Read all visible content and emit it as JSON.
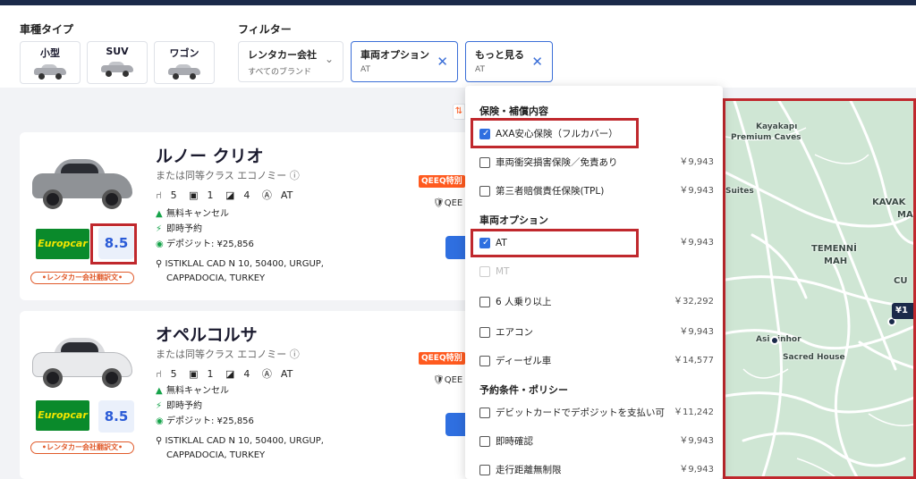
{
  "filters": {
    "car_type_label": "車種タイプ",
    "filter_label": "フィルター",
    "car_types": [
      {
        "label": "小型"
      },
      {
        "label": "SUV"
      },
      {
        "label": "ワゴン"
      }
    ],
    "rental_company": {
      "title": "レンタカー会社",
      "value": "すべてのブランド"
    },
    "vehicle_option": {
      "title": "車両オプション",
      "value": "AT"
    },
    "more": {
      "title": "もっと見る",
      "value": "AT"
    },
    "clear_icon": "✕",
    "chevron_icon": "⌄"
  },
  "results": [
    {
      "name": "ルノー クリオ",
      "subtitle": "または同等クラス エコノミー ⓘ",
      "seats": "5",
      "bags_large": "1",
      "doors": "4",
      "transmission": "AT",
      "free_cancel": "無料キャンセル",
      "instant": "即時予約",
      "deposit": "デポジット: ¥25,856",
      "supplier": "Europcar",
      "score": "8.5",
      "badge": "•レンタカー会社翻訳文•",
      "address_line1": "ISTIKLAL CAD N 10, 50400, URGUP,",
      "address_line2": "CAPPADOCIA, TURKEY",
      "promo": "QEEQ特別",
      "promo2": "QEE",
      "car_color": "#8f9296"
    },
    {
      "name": "オペルコルサ",
      "subtitle": "または同等クラス エコノミー ⓘ",
      "seats": "5",
      "bags_large": "1",
      "doors": "4",
      "transmission": "AT",
      "free_cancel": "無料キャンセル",
      "instant": "即時予約",
      "deposit": "デポジット: ¥25,856",
      "supplier": "Europcar",
      "score": "8.5",
      "badge": "•レンタカー会社翻訳文•",
      "address_line1": "ISTIKLAL CAD N 10, 50400, URGUP,",
      "address_line2": "CAPPADOCIA, TURKEY",
      "promo": "QEEQ特別",
      "promo2": "QEE",
      "car_color": "#e9eaec"
    }
  ],
  "dropdown": {
    "section_insurance": "保険・補償内容",
    "section_vehicle": "車両オプション",
    "section_policy": "予約条件・ポリシー",
    "items": [
      {
        "label": "AXA安心保険（フルカバー）",
        "price": "",
        "checked": true
      },
      {
        "label": "車両衝突損害保険／免責あり",
        "price": "￥9,943",
        "checked": false
      },
      {
        "label": "第三者賠償責任保険(TPL)",
        "price": "￥9,943",
        "checked": false
      },
      {
        "label": "AT",
        "price": "￥9,943",
        "checked": true
      },
      {
        "label": "MT",
        "price": "",
        "checked": false,
        "disabled": true
      },
      {
        "label": "6 人乗り以上",
        "price": "￥32,292",
        "checked": false
      },
      {
        "label": "エアコン",
        "price": "￥9,943",
        "checked": false
      },
      {
        "label": "ディーゼル車",
        "price": "￥14,577",
        "checked": false
      },
      {
        "label": "デビットカードでデポジットを支払い可",
        "price": "￥11,242",
        "checked": false
      },
      {
        "label": "即時確認",
        "price": "￥9,943",
        "checked": false
      },
      {
        "label": "走行距離無制限",
        "price": "￥9,943",
        "checked": false
      }
    ],
    "check_mark": "✓"
  },
  "map": {
    "labels": [
      "Kayakapı",
      "Premium Caves",
      "Suites",
      "KAVAK",
      "MA",
      "TEMENNİ",
      "MAH",
      "CU",
      "Asi",
      "inhor",
      "Sacred House"
    ],
    "price_pin": "¥1"
  },
  "sort_icon": "⇅",
  "colors": {
    "accent": "#2f6fe0",
    "highlight": "#c0282d",
    "promo": "#ff5a1f",
    "brand_green": "#0a8a2b"
  }
}
